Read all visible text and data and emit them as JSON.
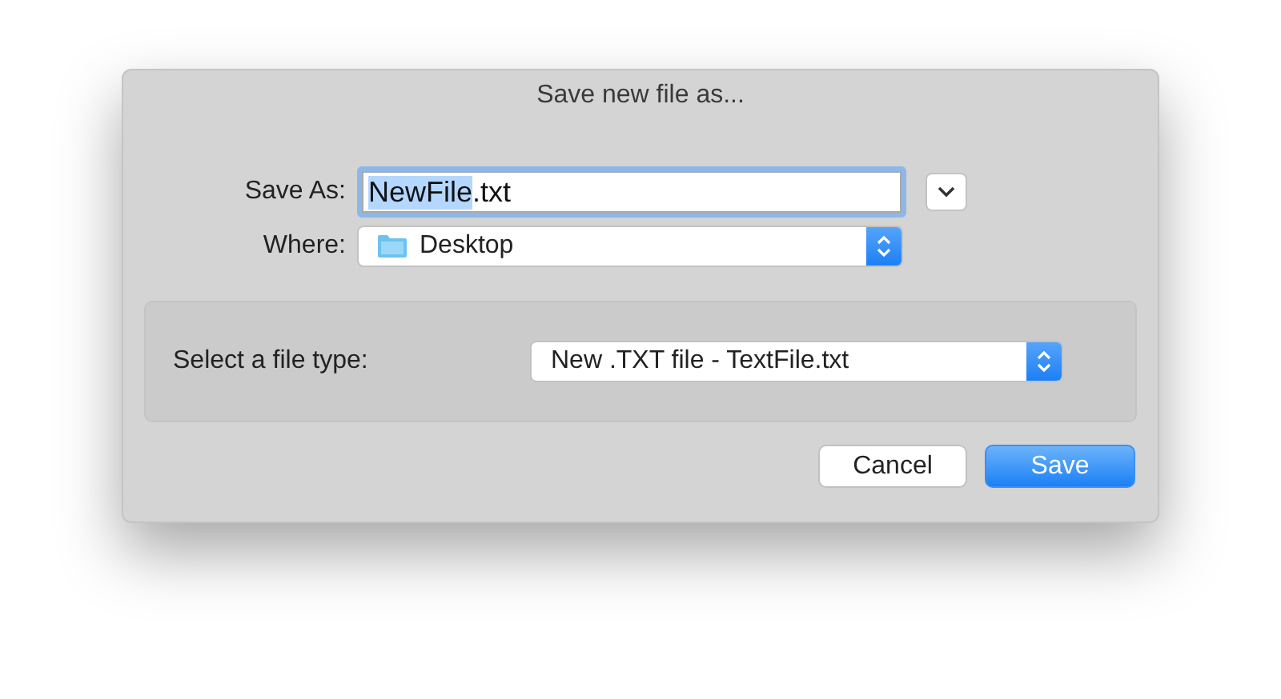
{
  "window": {
    "title": "Save new file as..."
  },
  "save_as": {
    "label": "Save As:",
    "value_parts": [
      {
        "text": "NewFile",
        "selected": true
      },
      {
        "text": ".txt",
        "selected": false
      }
    ],
    "expanded": false
  },
  "where": {
    "label": "Where:",
    "value": "Desktop"
  },
  "file_type": {
    "label": "Select a file type:",
    "value": "New .TXT file - TextFile.txt"
  },
  "buttons": [
    {
      "label": "Cancel",
      "kind": "secondary"
    },
    {
      "label": "Save",
      "kind": "default"
    }
  ]
}
